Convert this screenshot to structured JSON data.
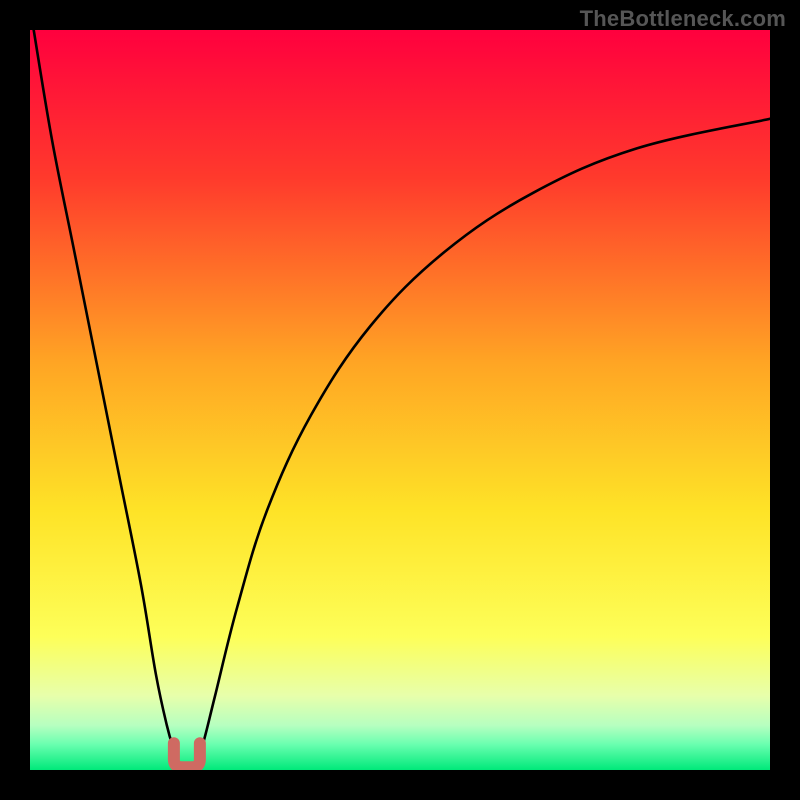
{
  "watermark": "TheBottleneck.com",
  "chart_data": {
    "type": "line",
    "title": "",
    "xlabel": "",
    "ylabel": "",
    "xlim": [
      0,
      100
    ],
    "ylim": [
      0,
      100
    ],
    "grid": false,
    "legend": false,
    "background": {
      "type": "vertical_gradient",
      "stops": [
        {
          "pos": 0.0,
          "color": "#ff003e"
        },
        {
          "pos": 0.2,
          "color": "#ff3a2c"
        },
        {
          "pos": 0.45,
          "color": "#ffa524"
        },
        {
          "pos": 0.65,
          "color": "#fee327"
        },
        {
          "pos": 0.82,
          "color": "#fdff59"
        },
        {
          "pos": 0.9,
          "color": "#e7ffab"
        },
        {
          "pos": 0.94,
          "color": "#b6ffc0"
        },
        {
          "pos": 0.965,
          "color": "#6bffb0"
        },
        {
          "pos": 1.0,
          "color": "#00e97a"
        }
      ]
    },
    "series": [
      {
        "name": "left-branch",
        "x": [
          0.5,
          3,
          6,
          9,
          12,
          15,
          17,
          18.5,
          19.5,
          20.0
        ],
        "y": [
          100,
          85,
          70,
          55,
          40,
          25,
          13,
          6,
          2.5,
          1.0
        ]
      },
      {
        "name": "right-branch",
        "x": [
          22.5,
          23.5,
          25,
          28,
          32,
          38,
          46,
          56,
          68,
          82,
          100
        ],
        "y": [
          1.0,
          4,
          10,
          22,
          35,
          48,
          60,
          70,
          78,
          84,
          88
        ]
      }
    ],
    "marker": {
      "name": "u-marker",
      "shape": "u",
      "x": 21.2,
      "y": 2.0,
      "color": "#cf6a62",
      "stroke_width": 12
    },
    "baseline": {
      "y": 0,
      "color": "#00e97a"
    }
  }
}
